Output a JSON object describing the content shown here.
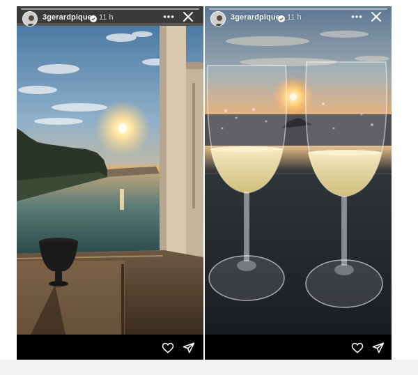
{
  "stories": [
    {
      "username": "3gerardpique",
      "timestamp": "11 h",
      "verified": true
    },
    {
      "username": "3gerardpique",
      "timestamp": "11 h",
      "verified": true
    }
  ],
  "icons": {
    "more": "more-options-icon",
    "close": "close-icon",
    "like": "heart-icon",
    "share": "send-icon",
    "verified": "verified-badge-icon"
  },
  "colors": {
    "header_text": "#ffffff",
    "footer_bg": "#000000",
    "verified_blue": "#3897f0"
  }
}
